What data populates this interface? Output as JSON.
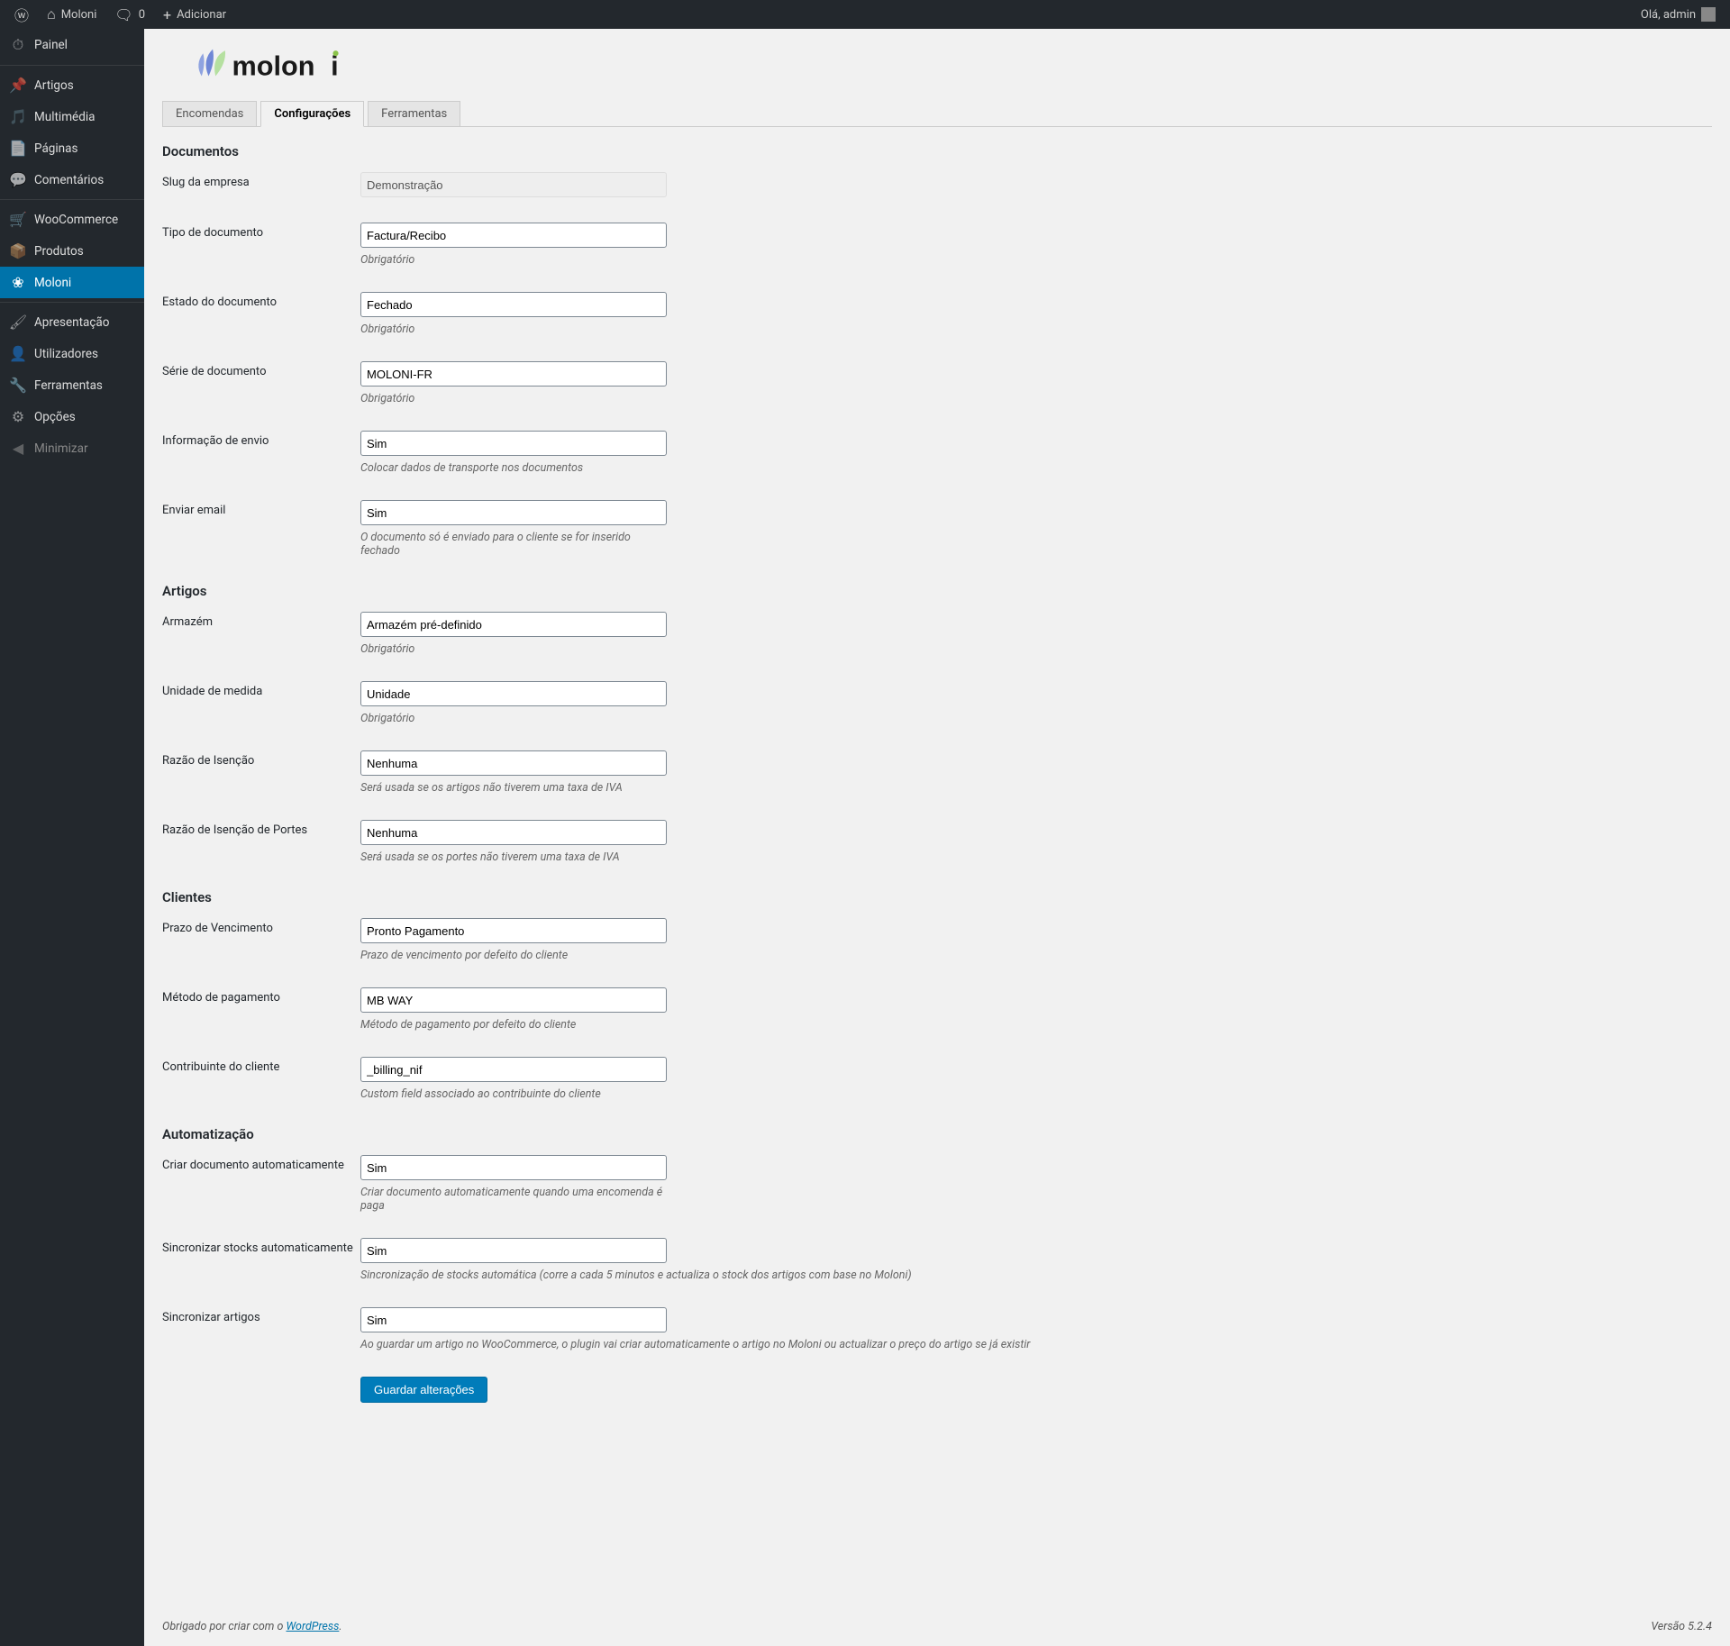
{
  "adminbar": {
    "site_name": "Moloni",
    "comments_count": "0",
    "add_new": "Adicionar",
    "greeting": "Olá, admin"
  },
  "sidebar": {
    "items": [
      {
        "label": "Painel",
        "icon": "dash"
      },
      {
        "label": "Artigos",
        "icon": "pin",
        "sep": true
      },
      {
        "label": "Multimédia",
        "icon": "media"
      },
      {
        "label": "Páginas",
        "icon": "page"
      },
      {
        "label": "Comentários",
        "icon": "comment"
      },
      {
        "label": "WooCommerce",
        "icon": "woo",
        "sep": true
      },
      {
        "label": "Produtos",
        "icon": "box"
      },
      {
        "label": "Moloni",
        "icon": "moloni",
        "current": true
      },
      {
        "label": "Apresentação",
        "icon": "brush",
        "sep": true
      },
      {
        "label": "Utilizadores",
        "icon": "users"
      },
      {
        "label": "Ferramentas",
        "icon": "tools"
      },
      {
        "label": "Opções",
        "icon": "settings"
      },
      {
        "label": "Minimizar",
        "icon": "collapse",
        "collapse": true
      }
    ]
  },
  "tabs": {
    "orders": "Encomendas",
    "settings": "Configurações",
    "tools": "Ferramentas"
  },
  "sections": {
    "documents": "Documentos",
    "articles": "Artigos",
    "clients": "Clientes",
    "automation": "Automatização"
  },
  "fields": {
    "company_slug": {
      "label": "Slug da empresa",
      "value": "Demonstração"
    },
    "doc_type": {
      "label": "Tipo de documento",
      "value": "Factura/Recibo",
      "desc": "Obrigatório"
    },
    "doc_status": {
      "label": "Estado do documento",
      "value": "Fechado",
      "desc": "Obrigatório"
    },
    "doc_series": {
      "label": "Série de documento",
      "value": "MOLONI-FR",
      "desc": "Obrigatório"
    },
    "ship_info": {
      "label": "Informação de envio",
      "value": "Sim",
      "desc": "Colocar dados de transporte nos documentos"
    },
    "send_email": {
      "label": "Enviar email",
      "value": "Sim",
      "desc": "O documento só é enviado para o cliente se for inserido fechado"
    },
    "warehouse": {
      "label": "Armazém",
      "value": "Armazém pré-definido",
      "desc": "Obrigatório"
    },
    "measure_unit": {
      "label": "Unidade de medida",
      "value": "Unidade",
      "desc": "Obrigatório"
    },
    "exemption": {
      "label": "Razão de Isenção",
      "value": "Nenhuma",
      "desc": "Será usada se os artigos não tiverem uma taxa de IVA"
    },
    "exemption_shipping": {
      "label": "Razão de Isenção de Portes",
      "value": "Nenhuma",
      "desc": "Será usada se os portes não tiverem uma taxa de IVA"
    },
    "maturity": {
      "label": "Prazo de Vencimento",
      "value": "Pronto Pagamento",
      "desc": "Prazo de vencimento por defeito do cliente"
    },
    "payment_method": {
      "label": "Método de pagamento",
      "value": "MB WAY",
      "desc": "Método de pagamento por defeito do cliente"
    },
    "vat_field": {
      "label": "Contribuinte do cliente",
      "value": "_billing_nif",
      "desc": "Custom field associado ao contribuinte do cliente"
    },
    "auto_doc": {
      "label": "Criar documento automaticamente",
      "value": "Sim",
      "desc": "Criar documento automaticamente quando uma encomenda é paga"
    },
    "sync_stock": {
      "label": "Sincronizar stocks automaticamente",
      "value": "Sim",
      "desc": "Sincronização de stocks automática (corre a cada 5 minutos e actualiza o stock dos artigos com base no Moloni)"
    },
    "sync_articles": {
      "label": "Sincronizar artigos",
      "value": "Sim",
      "desc": "Ao guardar um artigo no WooCommerce, o plugin vai criar automaticamente o artigo no Moloni ou actualizar o preço do artigo se já existir"
    }
  },
  "submit": "Guardar alterações",
  "footer": {
    "thanks_prefix": "Obrigado por criar com o ",
    "wp": "WordPress",
    "thanks_suffix": ".",
    "version": "Versão 5.2.4"
  }
}
